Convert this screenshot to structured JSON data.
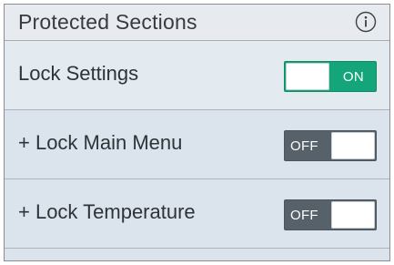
{
  "header": {
    "title": "Protected Sections",
    "info_icon": "info-circle-icon"
  },
  "rows": [
    {
      "label": "Lock Settings",
      "toggle": {
        "state": "ON",
        "on": true
      }
    },
    {
      "label": "+ Lock Main Menu",
      "toggle": {
        "state": "OFF",
        "on": false
      }
    },
    {
      "label": "+ Lock Temperature",
      "toggle": {
        "state": "OFF",
        "on": false
      }
    }
  ],
  "colors": {
    "toggle_on": "#14a67a",
    "toggle_off": "#56616a",
    "panel_background": "#dbe4ec"
  }
}
